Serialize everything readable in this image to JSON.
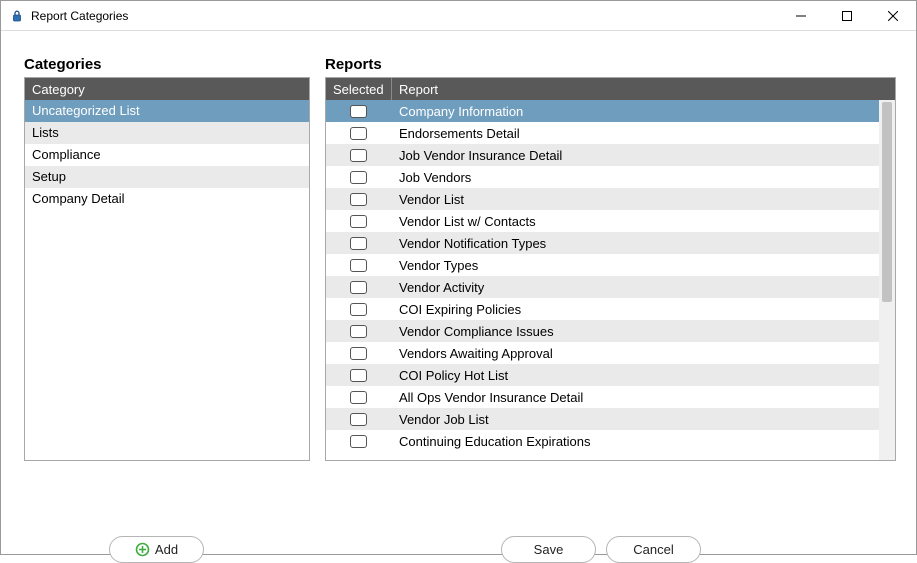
{
  "window": {
    "title": "Report Categories"
  },
  "labels": {
    "categories": "Categories",
    "reports": "Reports",
    "categoryHeader": "Category",
    "selectedHeader": "Selected",
    "reportHeader": "Report",
    "addBtn": "Add",
    "saveBtn": "Save",
    "cancelBtn": "Cancel"
  },
  "categories": [
    {
      "name": "Uncategorized List",
      "selected": true
    },
    {
      "name": "Lists",
      "selected": false
    },
    {
      "name": "Compliance",
      "selected": false
    },
    {
      "name": "Setup",
      "selected": false
    },
    {
      "name": "Company Detail",
      "selected": false
    }
  ],
  "reports": [
    {
      "name": "Company Information",
      "selected": true,
      "checked": false
    },
    {
      "name": "Endorsements Detail",
      "selected": false,
      "checked": false
    },
    {
      "name": "Job Vendor Insurance Detail",
      "selected": false,
      "checked": false
    },
    {
      "name": "Job Vendors",
      "selected": false,
      "checked": false
    },
    {
      "name": "Vendor List",
      "selected": false,
      "checked": false
    },
    {
      "name": "Vendor List w/ Contacts",
      "selected": false,
      "checked": false
    },
    {
      "name": "Vendor Notification Types",
      "selected": false,
      "checked": false
    },
    {
      "name": "Vendor Types",
      "selected": false,
      "checked": false
    },
    {
      "name": "Vendor Activity",
      "selected": false,
      "checked": false
    },
    {
      "name": "COI Expiring Policies",
      "selected": false,
      "checked": false
    },
    {
      "name": "Vendor Compliance Issues",
      "selected": false,
      "checked": false
    },
    {
      "name": "Vendors Awaiting Approval",
      "selected": false,
      "checked": false
    },
    {
      "name": "COI Policy Hot List",
      "selected": false,
      "checked": false
    },
    {
      "name": "All Ops Vendor Insurance Detail",
      "selected": false,
      "checked": false
    },
    {
      "name": "Vendor Job List",
      "selected": false,
      "checked": false
    },
    {
      "name": "Continuing Education Expirations",
      "selected": false,
      "checked": false
    }
  ]
}
